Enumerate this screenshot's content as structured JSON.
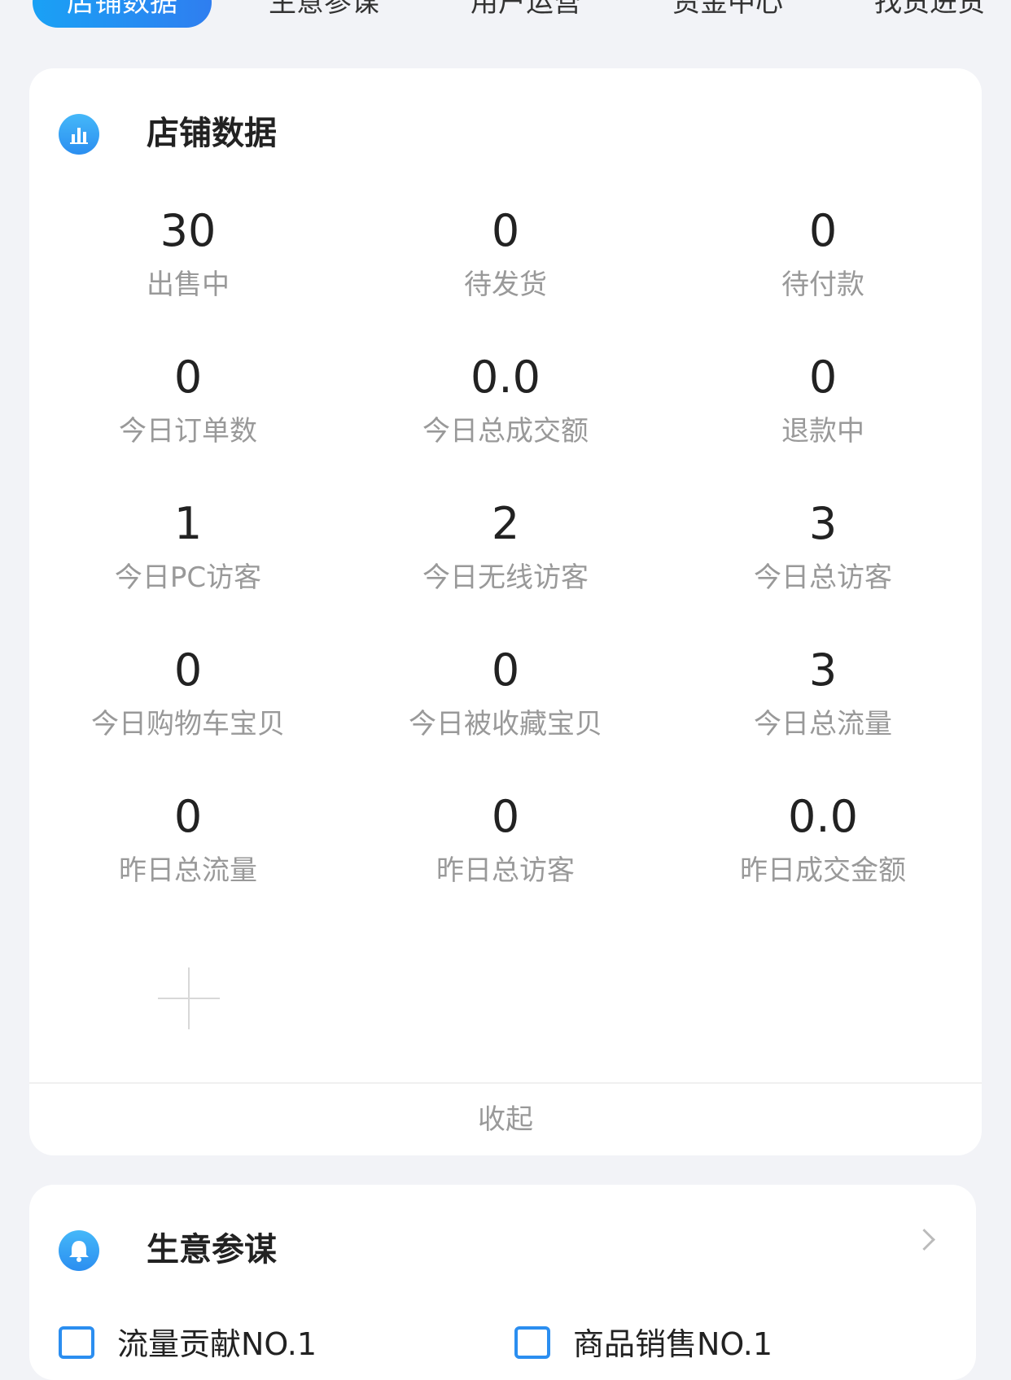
{
  "tabs": [
    {
      "label": "店铺数据",
      "active": true
    },
    {
      "label": "生意参谋"
    },
    {
      "label": "用户运营"
    },
    {
      "label": "资金中心"
    },
    {
      "label": "找货进货"
    }
  ],
  "store_data": {
    "title": "店铺数据",
    "icon": "bar-chart-icon",
    "stats": [
      {
        "value": "30",
        "label": "出售中"
      },
      {
        "value": "0",
        "label": "待发货"
      },
      {
        "value": "0",
        "label": "待付款"
      },
      {
        "value": "0",
        "label": "今日订单数"
      },
      {
        "value": "0.0",
        "label": "今日总成交额"
      },
      {
        "value": "0",
        "label": "退款中"
      },
      {
        "value": "1",
        "label": "今日PC访客"
      },
      {
        "value": "2",
        "label": "今日无线访客"
      },
      {
        "value": "3",
        "label": "今日总访客"
      },
      {
        "value": "0",
        "label": "今日购物车宝贝"
      },
      {
        "value": "0",
        "label": "今日被收藏宝贝"
      },
      {
        "value": "3",
        "label": "今日总流量"
      },
      {
        "value": "0",
        "label": "昨日总流量"
      },
      {
        "value": "0",
        "label": "昨日总访客"
      },
      {
        "value": "0.0",
        "label": "昨日成交金额"
      }
    ],
    "collapse_label": "收起"
  },
  "business_advisor": {
    "title": "生意参谋",
    "icon": "bell-icon",
    "items": [
      {
        "label": "流量贡献NO.1",
        "icon": "chart-icon"
      },
      {
        "label": "商品销售NO.1",
        "icon": "cup-icon"
      }
    ]
  },
  "colors": {
    "accent": "#2f7ef0",
    "background": "#f2f3f7"
  }
}
